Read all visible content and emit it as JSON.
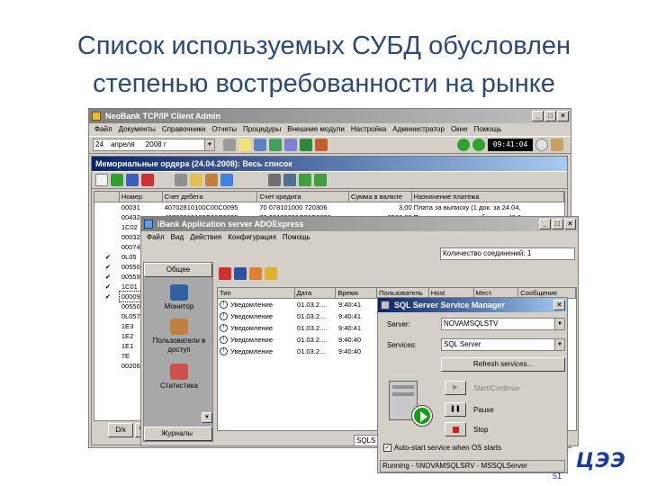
{
  "slide": {
    "title_line1": "Список используемых СУБД обусловлен",
    "title_line2": "степенью востребованности на рынке"
  },
  "bank_window": {
    "title": "NeoBank TCP/IP Client Admin",
    "menu": [
      "Файл",
      "Документы",
      "Справочники",
      "Отчеты",
      "Процедуры",
      "Внешние модули",
      "Настройка",
      "Администратор",
      "Окне",
      "Помощь"
    ],
    "date_day": "24",
    "date_month": "апреля",
    "date_year": "2008 г",
    "time": "09:41:04",
    "subwindow_title": "Мемориальные ордера (24.04.2008): Весь список",
    "columns": [
      "Номер",
      "Счет дебета",
      "Счет кредита",
      "Сумма в валюте",
      "Назначение платежа"
    ],
    "rows": [
      {
        "check": "",
        "num": "00031",
        "debit": "40702810100C00C0095",
        "credit": "70 078101000 720306",
        "sum": "3,00",
        "purpose": "Плата за выписку (1 док. за 24.04."
      },
      {
        "check": "",
        "num": "00432",
        "debit": "40702810100C00C0095",
        "credit": "70 28109700C00C0059",
        "sum": "9500,00",
        "purpose": "Плата за расчетное обслужив (2.0..."
      },
      {
        "check": "",
        "num": "1C02",
        "debit": "",
        "credit": "",
        "sum": "",
        "purpose": ""
      },
      {
        "check": "",
        "num": "00032",
        "debit": "",
        "credit": "",
        "sum": "",
        "purpose": ""
      },
      {
        "check": "",
        "num": "00074",
        "debit": "",
        "credit": "",
        "sum": "",
        "purpose": ""
      },
      {
        "check": "✔",
        "num": "0L05",
        "debit": "",
        "credit": "",
        "sum": "",
        "purpose": ""
      },
      {
        "check": "✔",
        "num": "00550",
        "debit": "",
        "credit": "",
        "sum": "",
        "purpose": ""
      },
      {
        "check": "✔",
        "num": "00559",
        "debit": "",
        "credit": "",
        "sum": "",
        "purpose": ""
      },
      {
        "check": "✔",
        "num": "1C01",
        "debit": "",
        "credit": "",
        "sum": "",
        "purpose": ""
      },
      {
        "check": "✔",
        "num": "00009",
        "debit": "",
        "credit": "",
        "sum": "",
        "purpose": ""
      },
      {
        "check": "",
        "num": "00550",
        "debit": "",
        "credit": "",
        "sum": "",
        "purpose": ""
      },
      {
        "check": "",
        "num": "0L057",
        "debit": "",
        "credit": "",
        "sum": "",
        "purpose": ""
      },
      {
        "check": "",
        "num": "1E3",
        "debit": "",
        "credit": "",
        "sum": "",
        "purpose": ""
      },
      {
        "check": "",
        "num": "1E2",
        "debit": "",
        "credit": "",
        "sum": "",
        "purpose": ""
      },
      {
        "check": "",
        "num": "1E1",
        "debit": "",
        "credit": "",
        "sum": "",
        "purpose": ""
      },
      {
        "check": "",
        "num": "7E",
        "debit": "",
        "credit": "",
        "sum": "",
        "purpose": ""
      },
      {
        "check": "",
        "num": "00206",
        "debit": "",
        "credit": "",
        "sum": "",
        "purpose": ""
      }
    ],
    "bottom_tabs": [
      "D/к",
      "Work"
    ]
  },
  "ibank_window": {
    "title": "iBank Application server ADOExpress",
    "menu": [
      "Файл",
      "Вид",
      "Действия",
      "Конфигурация",
      "Помощь"
    ],
    "connections_label": "Количество соединений:",
    "connections_value": "1",
    "nav_header": "Общее",
    "nav_items": [
      "Монитор",
      "Пользователи в доступ",
      "Статистика"
    ],
    "nav_footer": "Журналы",
    "columns": [
      "Тип",
      "Дата",
      "Время",
      "Пользователь",
      "Host",
      "Мест.",
      "Сообщение"
    ],
    "rows": [
      {
        "type": "Уведомление",
        "date": "01.03.2...",
        "time": "9:40:41"
      },
      {
        "type": "Уведомление",
        "date": "01.03.2...",
        "time": "9:40:41"
      },
      {
        "type": "Уведомление",
        "date": "01.03.2...",
        "time": "9:40:41"
      },
      {
        "type": "Уведомление",
        "date": "01.03.2...",
        "time": "9:40:40"
      },
      {
        "type": "Уведомление",
        "date": "01.03.2...",
        "time": "9:40:40"
      }
    ],
    "status_text": "SQLS"
  },
  "sql_window": {
    "title": "SQL Server Service Manager",
    "server_label": "Server:",
    "server_value": "NOVAMSQLSTV",
    "services_label": "Services:",
    "services_value": "SQL Server",
    "refresh_label": "Refresh services...",
    "start_label": "Start/Continue",
    "pause_label": "Pause",
    "stop_label": "Stop",
    "autostart_label": "Auto-start service when OS starts",
    "status_text": "Running - \\\\NOVAMSQLSRV - MSSQLServer"
  },
  "logo_text": "ЦЭЭ",
  "page_number": "51",
  "colors": {
    "title_blue": "#2b4a7a",
    "active_title": "#0a246a",
    "window_face": "#d4d0c8",
    "logo_blue": "#1a3aa0"
  }
}
